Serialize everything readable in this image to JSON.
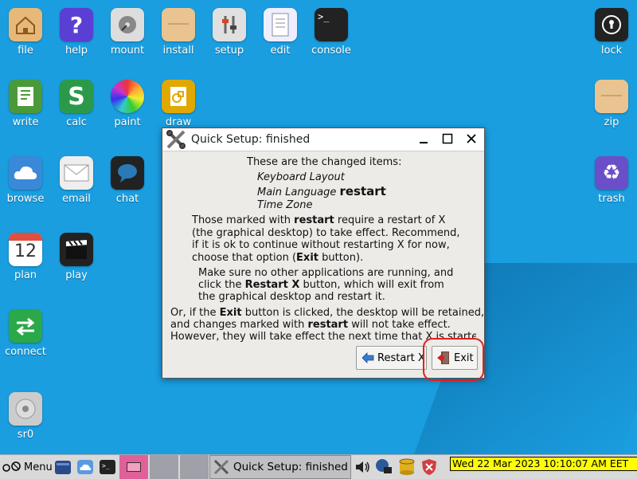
{
  "desktop": {
    "icons": [
      {
        "label": "file"
      },
      {
        "label": "help"
      },
      {
        "label": "mount"
      },
      {
        "label": "install"
      },
      {
        "label": "setup"
      },
      {
        "label": "edit"
      },
      {
        "label": "console"
      },
      {
        "label": "lock"
      },
      {
        "label": "write"
      },
      {
        "label": "calc"
      },
      {
        "label": "paint"
      },
      {
        "label": "draw"
      },
      {
        "label": "zip"
      },
      {
        "label": "browse"
      },
      {
        "label": "email"
      },
      {
        "label": "chat"
      },
      {
        "label": "trash"
      },
      {
        "label": "plan"
      },
      {
        "label": "play"
      },
      {
        "label": "connect"
      },
      {
        "label": "sr0"
      }
    ],
    "plan_day": "12"
  },
  "dialog": {
    "title": "Quick Setup: finished",
    "heading": "These are the changed items:",
    "items": [
      "Keyboard Layout",
      "Main Language",
      "Time Zone"
    ],
    "restart_tag": "restart",
    "p1": [
      [
        "Those marked with ",
        "restart",
        " require a restart of X"
      ],
      "(the graphical desktop) to take effect. Recommend,",
      "if it is ok to continue without restarting X for now,",
      [
        "choose that option (",
        "Exit",
        " button)."
      ]
    ],
    "p2": [
      "Make sure no other applications are running, and",
      [
        "click the ",
        "Restart X",
        " button, which will exit from"
      ],
      "the graphical desktop and restart it."
    ],
    "p3": [
      [
        "Or, if the ",
        "Exit",
        " button is clicked, the desktop will be retained,"
      ],
      [
        "and changes marked with ",
        "restart",
        " will not take effect."
      ],
      "However, they will take effect the next time that X is started."
    ],
    "restart_button": "Restart X",
    "exit_button": "Exit"
  },
  "taskbar": {
    "menu_label": "Menu",
    "active_task": "Quick Setup: finished",
    "clock": "Wed 22 Mar 2023 10:10:07 AM EET"
  },
  "colors": {
    "desktop_bg": "#1a9ee0",
    "highlight_ring": "#e02020",
    "clock_bg": "#ffff00"
  }
}
